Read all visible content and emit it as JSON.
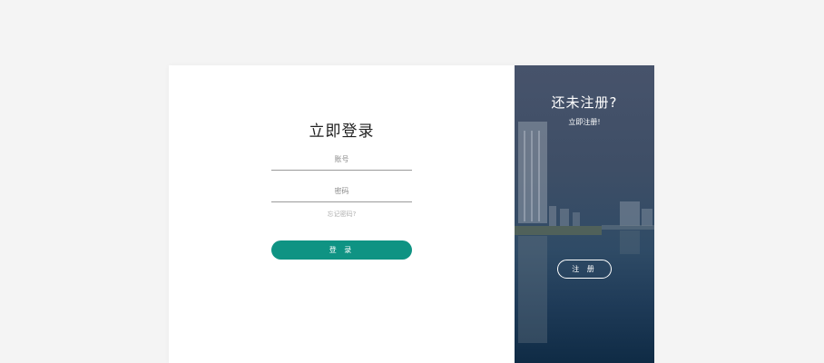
{
  "login": {
    "title": "立即登录",
    "account_placeholder": "账号",
    "password_placeholder": "密码",
    "forgot_label": "忘记密码?",
    "submit_label": "登 录"
  },
  "register": {
    "title": "还未注册?",
    "subtitle": "立即注册!",
    "button_label": "注 册"
  },
  "colors": {
    "page_bg": "#f4f4f4",
    "primary": "#0f9383",
    "panel_dark": "#2f4b66"
  }
}
